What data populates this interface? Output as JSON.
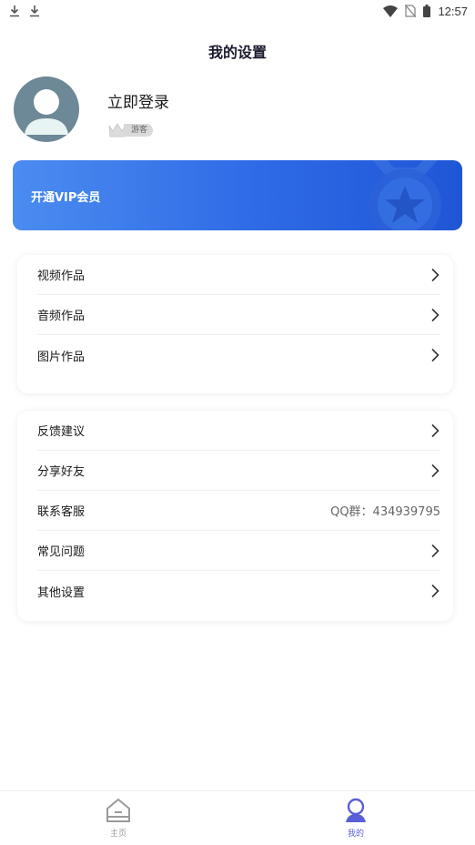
{
  "status_bar": {
    "time": "12:57"
  },
  "header": {
    "title": "我的设置"
  },
  "profile": {
    "login_label": "立即登录",
    "badge_label": "游客"
  },
  "vip": {
    "label": "开通VIP会员"
  },
  "works_section": {
    "items": [
      {
        "label": "视频作品",
        "icon": "chevron-right-icon"
      },
      {
        "label": "音频作品",
        "icon": "chevron-right-icon"
      },
      {
        "label": "图片作品",
        "icon": "chevron-right-icon"
      }
    ]
  },
  "more_section": {
    "items": [
      {
        "label": "反馈建议",
        "icon": "chevron-right-icon"
      },
      {
        "label": "分享好友",
        "icon": "chevron-right-icon"
      },
      {
        "label": "联系客服",
        "value": "QQ群：434939795"
      },
      {
        "label": "常见问题",
        "icon": "chevron-right-icon"
      },
      {
        "label": "其他设置",
        "icon": "chevron-right-icon"
      }
    ]
  },
  "bottom_nav": {
    "items": [
      {
        "label": "主页",
        "icon": "home-icon",
        "active": false
      },
      {
        "label": "我的",
        "icon": "profile-icon",
        "active": true
      }
    ]
  },
  "colors": {
    "accent": "#5a5fd8",
    "vip_gradient_start": "#4b8cf0",
    "vip_gradient_end": "#1f56d6",
    "avatar_bg": "#6d8897"
  }
}
